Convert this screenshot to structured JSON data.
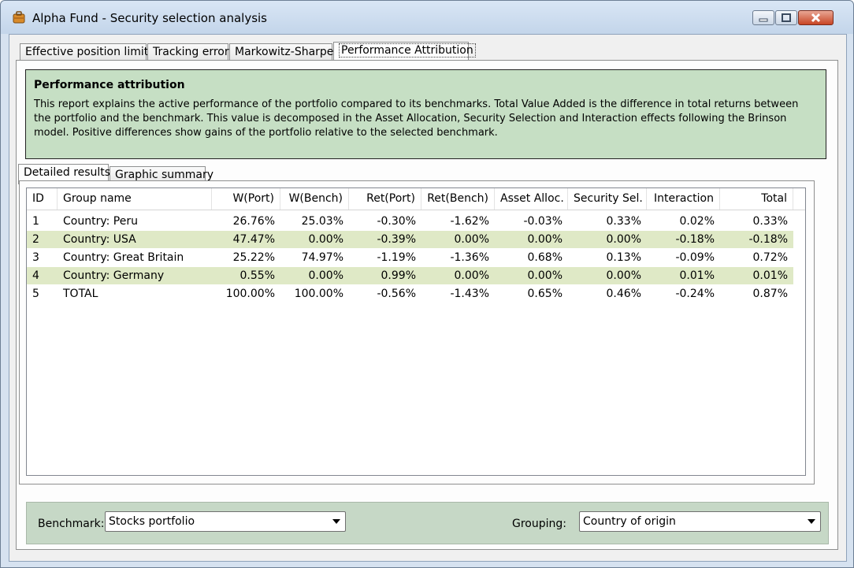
{
  "window": {
    "title": "Alpha Fund - Security selection analysis"
  },
  "tabs": [
    {
      "label": "Effective position limits"
    },
    {
      "label": "Tracking error"
    },
    {
      "label": "Markowitz-Sharpe"
    },
    {
      "label": "Performance Attribution"
    }
  ],
  "info": {
    "title": "Performance attribution",
    "text": "This report explains the active performance of the portfolio compared to its benchmarks. Total Value Added is the difference in total returns between the portfolio and the benchmark. This value is decomposed in the Asset Allocation, Security Selection and Interaction effects following the Brinson model. Positive differences show gains of the portfolio relative to the selected benchmark."
  },
  "inner_tabs": [
    {
      "label": "Detailed results"
    },
    {
      "label": "Graphic summary"
    }
  ],
  "table": {
    "headers": [
      "ID",
      "Group name",
      "W(Port)",
      "W(Bench)",
      "Ret(Port)",
      "Ret(Bench)",
      "Asset Alloc.",
      "Security Sel.",
      "Interaction",
      "Total"
    ],
    "rows": [
      [
        "1",
        "Country: Peru",
        "26.76%",
        "25.03%",
        "-0.30%",
        "-1.62%",
        "-0.03%",
        "0.33%",
        "0.02%",
        "0.33%"
      ],
      [
        "2",
        "Country: USA",
        "47.47%",
        "0.00%",
        "-0.39%",
        "0.00%",
        "0.00%",
        "0.00%",
        "-0.18%",
        "-0.18%"
      ],
      [
        "3",
        "Country: Great Britain",
        "25.22%",
        "74.97%",
        "-1.19%",
        "-1.36%",
        "0.68%",
        "0.13%",
        "-0.09%",
        "0.72%"
      ],
      [
        "4",
        "Country: Germany",
        "0.55%",
        "0.00%",
        "0.99%",
        "0.00%",
        "0.00%",
        "0.00%",
        "0.01%",
        "0.01%"
      ],
      [
        "5",
        "TOTAL",
        "100.00%",
        "100.00%",
        "-0.56%",
        "-1.43%",
        "0.65%",
        "0.46%",
        "-0.24%",
        "0.87%"
      ]
    ]
  },
  "benchmark": {
    "label": "Benchmark:",
    "value": "Stocks portfolio"
  },
  "grouping": {
    "label": "Grouping:",
    "value": "Country of origin"
  },
  "colors": {
    "info_bg": "#c6dfc4",
    "row_highlight": "#dfe9c6",
    "bottom_bar": "#c6d8c6"
  }
}
